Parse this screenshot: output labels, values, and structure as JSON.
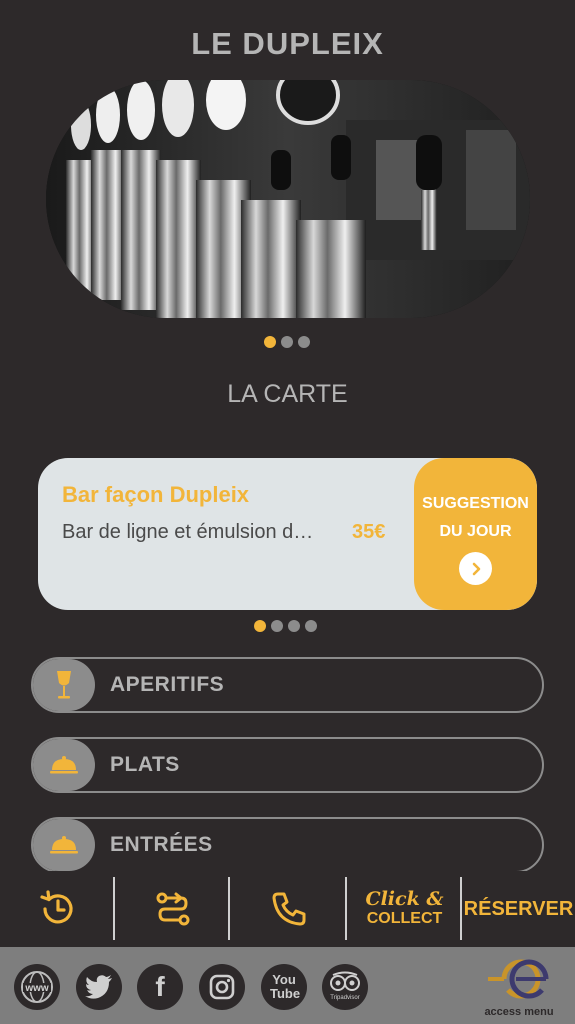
{
  "app": {
    "title": "LE DUPLEIX"
  },
  "hero": {
    "slides": 3,
    "active": 0
  },
  "section": {
    "title": "LA CARTE"
  },
  "promo": {
    "name": "Bar façon Dupleix",
    "description": "Bar de ligne et émulsion d…",
    "price": "35€",
    "side_label": "SUGGESTION DU JOUR",
    "slides": 4,
    "active": 0
  },
  "categories": [
    {
      "label": "APERITIFS",
      "icon": "wine-glass-icon"
    },
    {
      "label": "PLATS",
      "icon": "cloche-icon"
    },
    {
      "label": "ENTRÉES",
      "icon": "cloche-icon"
    }
  ],
  "actionbar": {
    "history_icon": "history-icon",
    "route_icon": "route-icon",
    "phone_icon": "phone-icon",
    "click_collect_top": "Click &",
    "click_collect_bottom": "COLLECT",
    "reserve_label": "RÉSERVER"
  },
  "footer": {
    "social": [
      {
        "name": "www-icon",
        "label": "www"
      },
      {
        "name": "twitter-icon",
        "label": ""
      },
      {
        "name": "facebook-icon",
        "label": "f"
      },
      {
        "name": "instagram-icon",
        "label": ""
      },
      {
        "name": "youtube-icon",
        "label": "You Tube"
      },
      {
        "name": "tripadvisor-icon",
        "label": "Tripadvisor"
      }
    ],
    "brand": "access menu"
  },
  "colors": {
    "accent": "#f2b53a",
    "background": "#2d292a",
    "footer": "#7e7e7e",
    "card": "#dfe4e6",
    "muted": "#b5b5b5"
  }
}
